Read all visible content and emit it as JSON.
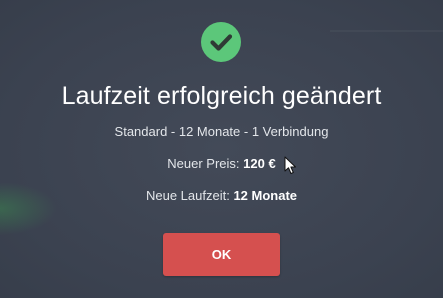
{
  "colors": {
    "background": "#3d4452",
    "success": "#5cc77a",
    "ok_button": "#d5504f",
    "text": "#ffffff"
  },
  "dialog": {
    "icon": "checkmark-circle-icon",
    "title": "Laufzeit erfolgreich geändert",
    "subtitle": "Standard - 12 Monate - 1 Verbindung",
    "price_label": "Neuer Preis:",
    "price_value": "120 €",
    "term_label": "Neue Laufzeit:",
    "term_value": "12 Monate",
    "ok_label": "OK"
  }
}
